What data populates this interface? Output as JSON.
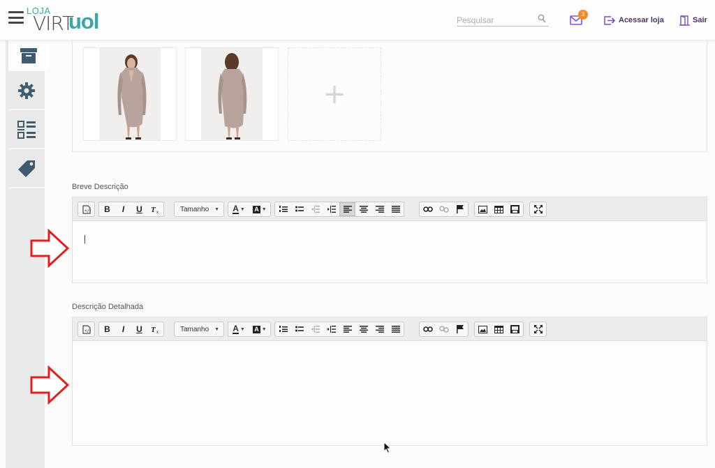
{
  "header": {
    "logo_top": "LOJA",
    "logo_virt": "VIRT",
    "logo_uol": "uol",
    "search_placeholder": "Pesquisar",
    "mail_badge": "3",
    "store_link": "Acessar loja",
    "exit_link": "Sair"
  },
  "sidebar": {
    "items": [
      {
        "icon": "archive-icon",
        "active": true
      },
      {
        "icon": "gear-icon",
        "active": false
      },
      {
        "icon": "dashboard-icon",
        "active": false
      },
      {
        "icon": "tag-icon",
        "active": false
      }
    ]
  },
  "images": {
    "items": [
      "product-photo-front",
      "product-photo-back"
    ],
    "add_symbol": "+"
  },
  "short_description": {
    "label": "Breve Descrição",
    "size_dropdown": "Tamanho",
    "content": ""
  },
  "detailed_description": {
    "label": "Descrição Detalhada",
    "size_dropdown": "Tamanho",
    "content": ""
  },
  "toolbar": {
    "bold": "B",
    "italic": "I",
    "underline": "U",
    "text_color": "A",
    "bg_color": "A"
  },
  "colors": {
    "brand_teal": "#3aa6a6",
    "annotation_red": "#e02020",
    "badge_orange": "#f08a24",
    "header_link_purple": "#4a3566"
  }
}
